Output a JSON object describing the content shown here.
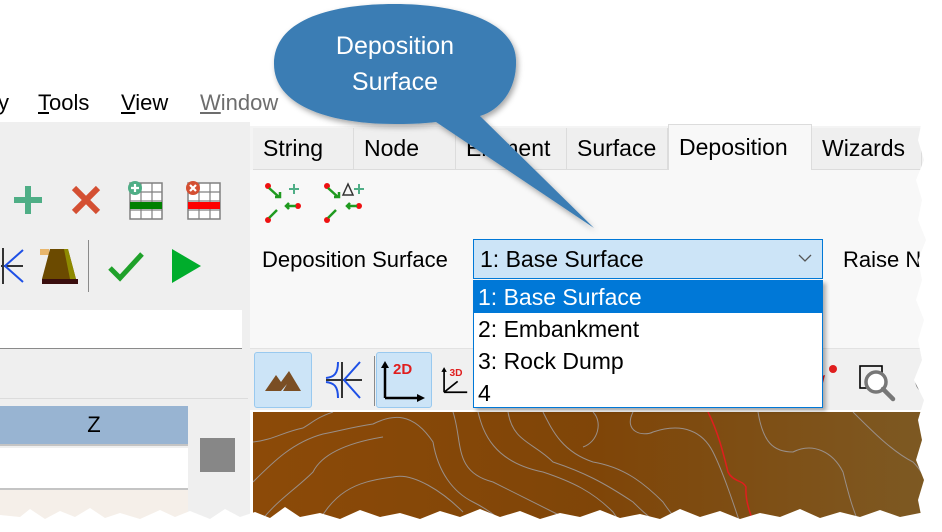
{
  "menubar": {
    "items": [
      {
        "label": "y",
        "underline": "",
        "rest": "y",
        "disabled": false
      },
      {
        "label": "Tools",
        "underline": "T",
        "rest": "ools",
        "disabled": false
      },
      {
        "label": "View",
        "underline": "V",
        "rest": "iew",
        "disabled": false
      },
      {
        "label": "Window",
        "underline": "W",
        "rest": "indow",
        "disabled": true
      }
    ]
  },
  "left_toolbar": {
    "row1": [
      {
        "icon": "add-icon",
        "color": "#4fae86"
      },
      {
        "icon": "delete-icon",
        "color": "#d44f32"
      },
      {
        "icon": "insert-row-table-icon",
        "color": "#008000"
      },
      {
        "icon": "delete-row-table-icon",
        "color": "#ff0000"
      }
    ],
    "row2": [
      {
        "icon": "intersect-lines-icon"
      },
      {
        "icon": "embankment-icon"
      },
      {
        "icon": "checkmark-icon",
        "color": "#1fa12a"
      },
      {
        "icon": "play-icon",
        "color": "#00ad2c"
      }
    ]
  },
  "grid": {
    "column_header": "Z"
  },
  "ribbon": {
    "tabs": [
      {
        "label": "String",
        "active": false
      },
      {
        "label": "Node",
        "active": false
      },
      {
        "label": "Element",
        "active": false
      },
      {
        "label": "Surface",
        "active": false
      },
      {
        "label": "Deposition",
        "active": true
      },
      {
        "label": "Wizards",
        "active": false
      }
    ],
    "deposition_tools": [
      {
        "icon": "add-deposition-node-icon",
        "badge": "+"
      },
      {
        "icon": "add-delta-deposition-node-icon",
        "badge": "Δ+"
      }
    ],
    "deposition_surface_label": "Deposition Surface",
    "deposition_surface_value": "1: Base Surface",
    "raise_label": "Raise N",
    "dropdown_options": [
      {
        "label": "1: Base Surface",
        "selected": true
      },
      {
        "label": "2: Embankment",
        "selected": false
      },
      {
        "label": "3: Rock Dump",
        "selected": false
      },
      {
        "label": "4",
        "selected": false
      }
    ]
  },
  "view_toolbar": {
    "buttons": [
      {
        "icon": "terrain-icon",
        "active": true
      },
      {
        "icon": "intersect-lines-icon",
        "active": false
      },
      {
        "icon": "view-2d-icon",
        "text": "2D",
        "active": true
      },
      {
        "icon": "view-3d-icon",
        "text": "3D",
        "active": false
      },
      {
        "icon": "pick-point-icon",
        "active": false
      },
      {
        "icon": "zoom-window-icon",
        "active": false
      },
      {
        "icon": "rotate-icon",
        "active": false
      }
    ]
  },
  "callout": {
    "line1": "Deposition",
    "line2": "Surface",
    "color": "#3a7db4"
  },
  "colors": {
    "accent": "#0078d7",
    "combo_bg": "#cce4f7",
    "grid_header": "#98b4d2",
    "map_brown": "#8a4a0a"
  }
}
